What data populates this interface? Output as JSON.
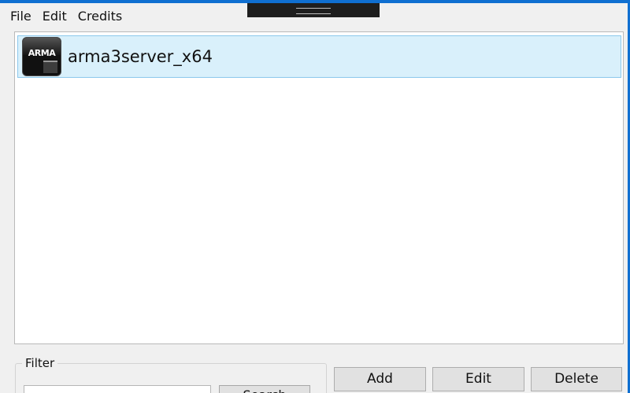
{
  "menu": {
    "items": [
      {
        "label": "File"
      },
      {
        "label": "Edit"
      },
      {
        "label": "Credits"
      }
    ]
  },
  "list": {
    "items": [
      {
        "label": "arma3server_x64",
        "icon": "arma3-app-icon",
        "icon_text": "ARMA"
      }
    ]
  },
  "filter": {
    "legend": "Filter",
    "input_value": "",
    "search_label": "Search"
  },
  "buttons": {
    "add_label": "Add",
    "edit_label": "Edit",
    "delete_label": "Delete"
  },
  "colors": {
    "window_border": "#0f6fd1",
    "selection_bg": "#d9f0fb",
    "selection_border": "#8cc8ec",
    "button_bg": "#e1e1e1"
  }
}
